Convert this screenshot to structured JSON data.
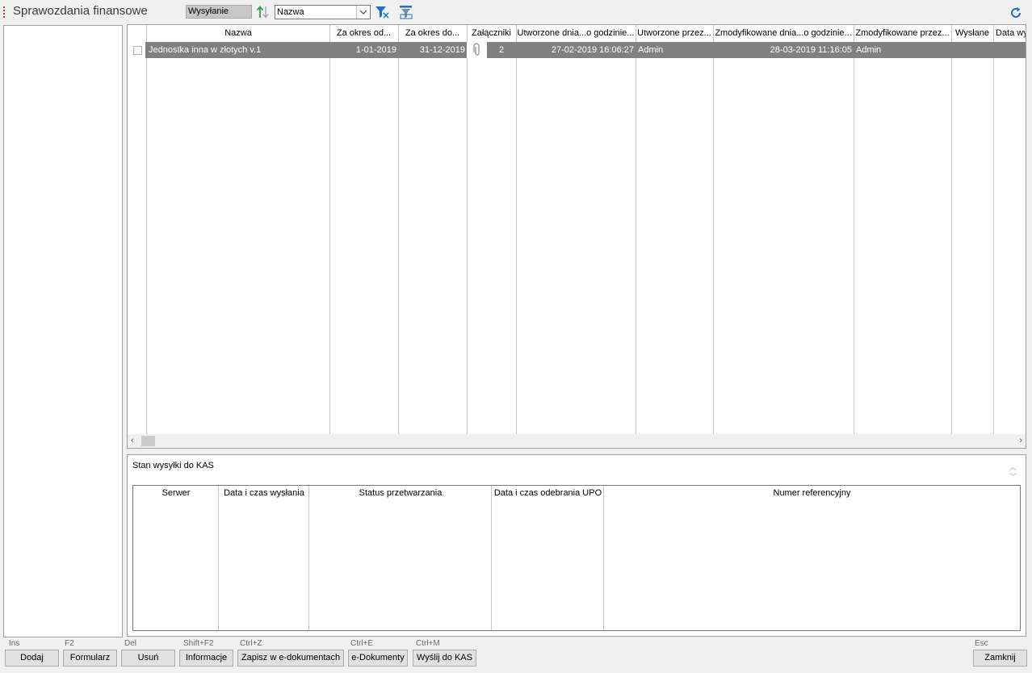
{
  "header": {
    "title": "Sprawozdania finansowe",
    "mode": "Wysyłanie",
    "sort_field": "Nazwa"
  },
  "grid": {
    "columns": [
      "Nazwa",
      "Za okres od...",
      "Za okres do...",
      "Załączniki",
      "Utworzone dnia...o godzinie...",
      "Utworzone przez...",
      "Zmodyfikowane dnia...o godzinie...",
      "Zmodyfikowane przez...",
      "Wysłane",
      "Data wy"
    ],
    "rows": [
      {
        "nazwa": "Jednostka inna w złotych v.1",
        "od": "1-01-2019",
        "do": "31-12-2019",
        "zalaczniki": "2",
        "utworzone_dnia": "27-02-2019 16:06:27",
        "utworzone_przez": "Admin",
        "zmodyfikowane_dnia": "28-03-2019 11:16:05",
        "zmodyfikowane_przez": "Admin",
        "wyslane": "",
        "data_wys": ""
      }
    ]
  },
  "kas": {
    "label": "Stan wysyłki do KAS",
    "columns": [
      "Serwer",
      "Data i czas wysłania",
      "Status przetwarzania",
      "Data i czas odebrania UPO",
      "Numer referencyjny"
    ]
  },
  "buttons": [
    {
      "shortcut": "Ins",
      "label": "Dodaj"
    },
    {
      "shortcut": "F2",
      "label": "Formularz"
    },
    {
      "shortcut": "Del",
      "label": "Usuń"
    },
    {
      "shortcut": "Shift+F2",
      "label": "Informacje"
    },
    {
      "shortcut": "Ctrl+Z",
      "label": "Zapisz w e-dokumentach"
    },
    {
      "shortcut": "Ctrl+E",
      "label": "e-Dokumenty"
    },
    {
      "shortcut": "Ctrl+M",
      "label": "Wyślij do KAS"
    },
    {
      "shortcut": "Esc",
      "label": "Zamknij"
    }
  ],
  "colors": {
    "selected_row": "#808080",
    "accent_blue": "#1f6fc5",
    "accent_green": "#3aa14a",
    "title_dots": "#c0392b"
  }
}
